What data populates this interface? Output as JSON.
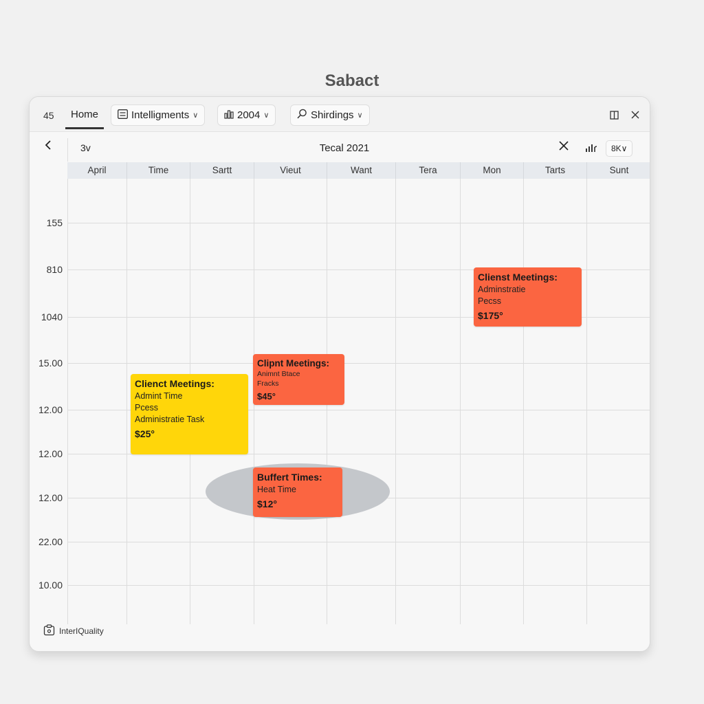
{
  "page": {
    "title": "Sabact"
  },
  "toolbar": {
    "number": "45",
    "home_tab": "Home",
    "intelligments": "Intelligments",
    "year": "2004",
    "search": "Shirdings"
  },
  "subbar": {
    "view": "3v",
    "title": "Tecal 2021",
    "pill": "8K∨"
  },
  "days": [
    "April",
    "Time",
    "Sartt",
    "Vieut",
    "Want",
    "Tera",
    "Mon",
    "Tarts",
    "Sunt"
  ],
  "times": [
    "155",
    "810",
    "1040",
    "15.00",
    "12.00",
    "12.00",
    "12.00",
    "22.00",
    "10.00"
  ],
  "events": {
    "client_mon": {
      "title": "Clienst Meetings:",
      "line1": "Adminstratie",
      "line2": "Pecss",
      "price": "$175°"
    },
    "client_vieut": {
      "title": "Clipnt Meetings:",
      "line1": "Animnt Btace",
      "line2": "Fracks",
      "price": "$45°"
    },
    "client_time": {
      "title": "Clienct Meetings:",
      "line1": "Admint Time",
      "line2": "Pcess",
      "line3": "Administratie Task",
      "price": "$25°"
    },
    "buffer": {
      "title": "Buffert Times:",
      "line1": "Heat Time",
      "price": "$12°"
    }
  },
  "footer": {
    "label": "InterIQuality"
  },
  "colors": {
    "orange_event": "#fb6541",
    "yellow_event": "#ffd60a",
    "header_band": "#e7eaee",
    "halo": "#c4c7cb"
  }
}
